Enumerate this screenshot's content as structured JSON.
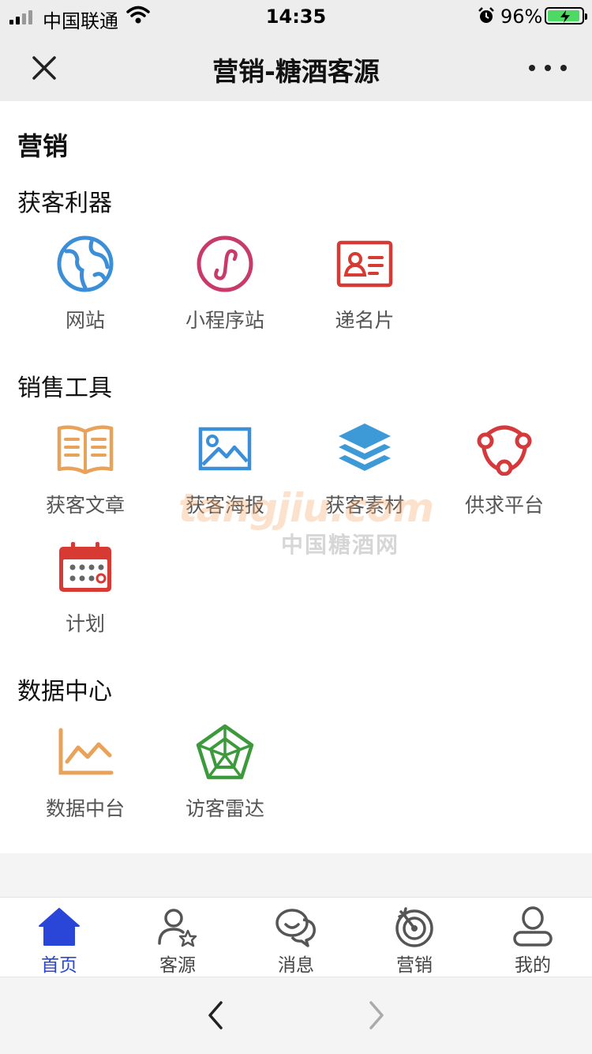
{
  "status_bar": {
    "carrier": "中国联通",
    "time": "14:35",
    "battery": "96%",
    "battery_level": 96
  },
  "nav": {
    "title": "营销-糖酒客源"
  },
  "content": {
    "heading": "营销",
    "sections": [
      {
        "title": "获客利器",
        "items": [
          {
            "label": "网站",
            "icon": "globe-icon",
            "color": "#3b8fd9"
          },
          {
            "label": "小程序站",
            "icon": "mini-program-icon",
            "color": "#c83a6a"
          },
          {
            "label": "递名片",
            "icon": "business-card-icon",
            "color": "#d63a32"
          }
        ]
      },
      {
        "title": "销售工具",
        "items": [
          {
            "label": "获客文章",
            "icon": "open-book-icon",
            "color": "#e8a25a"
          },
          {
            "label": "获客海报",
            "icon": "picture-icon",
            "color": "#3b8fd9"
          },
          {
            "label": "获客素材",
            "icon": "layers-icon",
            "color": "#3e9ad6"
          },
          {
            "label": "供求平台",
            "icon": "share-network-icon",
            "color": "#d6393c"
          },
          {
            "label": "计划",
            "icon": "calendar-icon",
            "color": "#d63a32"
          }
        ]
      },
      {
        "title": "数据中心",
        "items": [
          {
            "label": "数据中台",
            "icon": "line-chart-icon",
            "color": "#e8a25a"
          },
          {
            "label": "访客雷达",
            "icon": "radar-icon",
            "color": "#3c9a3c"
          }
        ]
      }
    ]
  },
  "watermark": {
    "latin": "tangjiu.com",
    "chinese": "中国糖酒网"
  },
  "tab_bar": {
    "active_color": "#2946d8",
    "tabs": [
      {
        "label": "首页",
        "icon": "home-icon",
        "active": true
      },
      {
        "label": "客源",
        "icon": "customer-source-icon",
        "active": false
      },
      {
        "label": "消息",
        "icon": "message-icon",
        "active": false
      },
      {
        "label": "营销",
        "icon": "target-icon",
        "active": false
      },
      {
        "label": "我的",
        "icon": "profile-icon",
        "active": false
      }
    ]
  }
}
